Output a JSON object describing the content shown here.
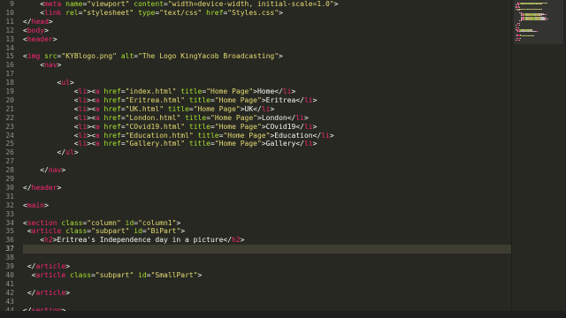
{
  "editor": {
    "lines": [
      {
        "num": "9",
        "indent": "    ",
        "tokens": [
          {
            "t": "<",
            "c": "pun"
          },
          {
            "t": "meta",
            "c": "tag"
          },
          {
            "t": " name",
            "c": "attr"
          },
          {
            "t": "=",
            "c": "pun"
          },
          {
            "t": "\"viewport\"",
            "c": "str"
          },
          {
            "t": " content",
            "c": "attr"
          },
          {
            "t": "=",
            "c": "pun"
          },
          {
            "t": "\"width=device-width, initial-scale=1.0\"",
            "c": "str"
          },
          {
            "t": ">",
            "c": "pun"
          }
        ]
      },
      {
        "num": "10",
        "indent": "    ",
        "tokens": [
          {
            "t": "<",
            "c": "pun"
          },
          {
            "t": "link",
            "c": "tag"
          },
          {
            "t": " rel",
            "c": "attr"
          },
          {
            "t": "=",
            "c": "pun"
          },
          {
            "t": "\"stylesheet\"",
            "c": "str"
          },
          {
            "t": " type",
            "c": "attr"
          },
          {
            "t": "=",
            "c": "pun"
          },
          {
            "t": "\"text/css\"",
            "c": "str"
          },
          {
            "t": " href",
            "c": "attr"
          },
          {
            "t": "=",
            "c": "pun"
          },
          {
            "t": "\"Styles.css\"",
            "c": "str"
          },
          {
            "t": ">",
            "c": "pun"
          }
        ]
      },
      {
        "num": "11",
        "indent": "",
        "tokens": [
          {
            "t": "</",
            "c": "pun"
          },
          {
            "t": "head",
            "c": "tag"
          },
          {
            "t": ">",
            "c": "pun"
          }
        ]
      },
      {
        "num": "12",
        "indent": "",
        "tokens": [
          {
            "t": "<",
            "c": "pun"
          },
          {
            "t": "body",
            "c": "tag"
          },
          {
            "t": ">",
            "c": "pun"
          }
        ]
      },
      {
        "num": "13",
        "indent": "",
        "tokens": [
          {
            "t": "<",
            "c": "pun"
          },
          {
            "t": "header",
            "c": "tag"
          },
          {
            "t": ">",
            "c": "pun"
          }
        ]
      },
      {
        "num": "14",
        "indent": "",
        "tokens": []
      },
      {
        "num": "15",
        "indent": "",
        "tokens": [
          {
            "t": "<",
            "c": "pun"
          },
          {
            "t": "img",
            "c": "tag"
          },
          {
            "t": " src",
            "c": "attr"
          },
          {
            "t": "=",
            "c": "pun"
          },
          {
            "t": "\"KYBlogo.png\"",
            "c": "str"
          },
          {
            "t": " alt",
            "c": "attr"
          },
          {
            "t": "=",
            "c": "pun"
          },
          {
            "t": "\"The Logo KingYacob Broadcasting\"",
            "c": "str"
          },
          {
            "t": ">",
            "c": "pun"
          }
        ]
      },
      {
        "num": "16",
        "indent": "    ",
        "tokens": [
          {
            "t": "<",
            "c": "pun"
          },
          {
            "t": "nav",
            "c": "tag"
          },
          {
            "t": ">",
            "c": "pun"
          }
        ]
      },
      {
        "num": "17",
        "indent": "",
        "tokens": []
      },
      {
        "num": "18",
        "indent": "        ",
        "tokens": [
          {
            "t": "<",
            "c": "pun"
          },
          {
            "t": "ul",
            "c": "tag"
          },
          {
            "t": ">",
            "c": "pun"
          }
        ]
      },
      {
        "num": "19",
        "indent": "            ",
        "tokens": [
          {
            "t": "<",
            "c": "pun"
          },
          {
            "t": "li",
            "c": "tag"
          },
          {
            "t": "><",
            "c": "pun"
          },
          {
            "t": "a",
            "c": "tag"
          },
          {
            "t": " href",
            "c": "attr"
          },
          {
            "t": "=",
            "c": "pun"
          },
          {
            "t": "\"index.html\"",
            "c": "str"
          },
          {
            "t": " title",
            "c": "attr"
          },
          {
            "t": "=",
            "c": "pun"
          },
          {
            "t": "\"Home Page\"",
            "c": "str"
          },
          {
            "t": ">Home</",
            "c": "txt"
          },
          {
            "t": "li",
            "c": "tag"
          },
          {
            "t": ">",
            "c": "pun"
          }
        ]
      },
      {
        "num": "20",
        "indent": "            ",
        "tokens": [
          {
            "t": "<",
            "c": "pun"
          },
          {
            "t": "li",
            "c": "tag"
          },
          {
            "t": "><",
            "c": "pun"
          },
          {
            "t": "a",
            "c": "tag"
          },
          {
            "t": " href",
            "c": "attr"
          },
          {
            "t": "=",
            "c": "pun"
          },
          {
            "t": "\"Eritrea.html\"",
            "c": "str"
          },
          {
            "t": " title",
            "c": "attr"
          },
          {
            "t": "=",
            "c": "pun"
          },
          {
            "t": "\"Home Page\"",
            "c": "str"
          },
          {
            "t": ">Eritrea</",
            "c": "txt"
          },
          {
            "t": "li",
            "c": "tag"
          },
          {
            "t": ">",
            "c": "pun"
          }
        ]
      },
      {
        "num": "21",
        "indent": "            ",
        "tokens": [
          {
            "t": "<",
            "c": "pun"
          },
          {
            "t": "li",
            "c": "tag"
          },
          {
            "t": "><",
            "c": "pun"
          },
          {
            "t": "a",
            "c": "tag"
          },
          {
            "t": " href",
            "c": "attr"
          },
          {
            "t": "=",
            "c": "pun"
          },
          {
            "t": "\"UK.html\"",
            "c": "str"
          },
          {
            "t": " title",
            "c": "attr"
          },
          {
            "t": "=",
            "c": "pun"
          },
          {
            "t": "\"Home Page\"",
            "c": "str"
          },
          {
            "t": ">UK</",
            "c": "txt"
          },
          {
            "t": "li",
            "c": "tag"
          },
          {
            "t": ">",
            "c": "pun"
          }
        ]
      },
      {
        "num": "22",
        "indent": "            ",
        "tokens": [
          {
            "t": "<",
            "c": "pun"
          },
          {
            "t": "li",
            "c": "tag"
          },
          {
            "t": "><",
            "c": "pun"
          },
          {
            "t": "a",
            "c": "tag"
          },
          {
            "t": " href",
            "c": "attr"
          },
          {
            "t": "=",
            "c": "pun"
          },
          {
            "t": "\"London.html\"",
            "c": "str"
          },
          {
            "t": " title",
            "c": "attr"
          },
          {
            "t": "=",
            "c": "pun"
          },
          {
            "t": "\"Home Page\"",
            "c": "str"
          },
          {
            "t": ">London</",
            "c": "txt"
          },
          {
            "t": "li",
            "c": "tag"
          },
          {
            "t": ">",
            "c": "pun"
          }
        ]
      },
      {
        "num": "23",
        "indent": "            ",
        "tokens": [
          {
            "t": "<",
            "c": "pun"
          },
          {
            "t": "li",
            "c": "tag"
          },
          {
            "t": "><",
            "c": "pun"
          },
          {
            "t": "a",
            "c": "tag"
          },
          {
            "t": " href",
            "c": "attr"
          },
          {
            "t": "=",
            "c": "pun"
          },
          {
            "t": "\"COvid19.html\"",
            "c": "str"
          },
          {
            "t": " title",
            "c": "attr"
          },
          {
            "t": "=",
            "c": "pun"
          },
          {
            "t": "\"Home Page\"",
            "c": "str"
          },
          {
            "t": ">COvid19</",
            "c": "txt"
          },
          {
            "t": "li",
            "c": "tag"
          },
          {
            "t": ">",
            "c": "pun"
          }
        ]
      },
      {
        "num": "24",
        "indent": "            ",
        "tokens": [
          {
            "t": "<",
            "c": "pun"
          },
          {
            "t": "li",
            "c": "tag"
          },
          {
            "t": "><",
            "c": "pun"
          },
          {
            "t": "a",
            "c": "tag"
          },
          {
            "t": " href",
            "c": "attr"
          },
          {
            "t": "=",
            "c": "pun"
          },
          {
            "t": "\"Education.html\"",
            "c": "str"
          },
          {
            "t": " title",
            "c": "attr"
          },
          {
            "t": "=",
            "c": "pun"
          },
          {
            "t": "\"Home Page\"",
            "c": "str"
          },
          {
            "t": ">Education</",
            "c": "txt"
          },
          {
            "t": "li",
            "c": "tag"
          },
          {
            "t": ">",
            "c": "pun"
          }
        ]
      },
      {
        "num": "25",
        "indent": "            ",
        "tokens": [
          {
            "t": "<",
            "c": "pun"
          },
          {
            "t": "li",
            "c": "tag"
          },
          {
            "t": "><",
            "c": "pun"
          },
          {
            "t": "a",
            "c": "tag"
          },
          {
            "t": " href",
            "c": "attr"
          },
          {
            "t": "=",
            "c": "pun"
          },
          {
            "t": "\"Gallery.html\"",
            "c": "str"
          },
          {
            "t": " title",
            "c": "attr"
          },
          {
            "t": "=",
            "c": "pun"
          },
          {
            "t": "\"Home Page\"",
            "c": "str"
          },
          {
            "t": ">Gallery</",
            "c": "txt"
          },
          {
            "t": "li",
            "c": "tag"
          },
          {
            "t": ">",
            "c": "pun"
          }
        ]
      },
      {
        "num": "26",
        "indent": "        ",
        "tokens": [
          {
            "t": "</",
            "c": "pun"
          },
          {
            "t": "ul",
            "c": "tag"
          },
          {
            "t": ">",
            "c": "pun"
          }
        ]
      },
      {
        "num": "27",
        "indent": "",
        "tokens": []
      },
      {
        "num": "28",
        "indent": "    ",
        "tokens": [
          {
            "t": "</",
            "c": "pun"
          },
          {
            "t": "nav",
            "c": "tag"
          },
          {
            "t": ">",
            "c": "pun"
          }
        ]
      },
      {
        "num": "29",
        "indent": "",
        "tokens": []
      },
      {
        "num": "30",
        "indent": "",
        "tokens": [
          {
            "t": "</",
            "c": "pun"
          },
          {
            "t": "header",
            "c": "tag"
          },
          {
            "t": ">",
            "c": "pun"
          }
        ]
      },
      {
        "num": "31",
        "indent": "",
        "tokens": []
      },
      {
        "num": "32",
        "indent": "",
        "tokens": [
          {
            "t": "<",
            "c": "pun"
          },
          {
            "t": "main",
            "c": "tag"
          },
          {
            "t": ">",
            "c": "pun"
          }
        ]
      },
      {
        "num": "33",
        "indent": "",
        "tokens": []
      },
      {
        "num": "34",
        "indent": "",
        "tokens": [
          {
            "t": "<",
            "c": "pun"
          },
          {
            "t": "section",
            "c": "tag"
          },
          {
            "t": " class",
            "c": "attr"
          },
          {
            "t": "=",
            "c": "pun"
          },
          {
            "t": "\"column\"",
            "c": "str"
          },
          {
            "t": " id",
            "c": "attr"
          },
          {
            "t": "=",
            "c": "pun"
          },
          {
            "t": "\"column1\"",
            "c": "str"
          },
          {
            "t": ">",
            "c": "pun"
          }
        ]
      },
      {
        "num": "35",
        "indent": " ",
        "tokens": [
          {
            "t": "<",
            "c": "pun"
          },
          {
            "t": "article",
            "c": "tag"
          },
          {
            "t": " class",
            "c": "attr"
          },
          {
            "t": "=",
            "c": "pun"
          },
          {
            "t": "\"subpart\"",
            "c": "str"
          },
          {
            "t": " id",
            "c": "attr"
          },
          {
            "t": "=",
            "c": "pun"
          },
          {
            "t": "\"BiPart\"",
            "c": "str"
          },
          {
            "t": ">",
            "c": "pun"
          }
        ]
      },
      {
        "num": "36",
        "indent": "    ",
        "tokens": [
          {
            "t": "<",
            "c": "pun"
          },
          {
            "t": "h2",
            "c": "tag"
          },
          {
            "t": ">Eritrea's Independence day in a picture</",
            "c": "txt"
          },
          {
            "t": "h2",
            "c": "tag"
          },
          {
            "t": ">",
            "c": "pun"
          }
        ]
      },
      {
        "num": "37",
        "indent": "",
        "tokens": [],
        "current": true
      },
      {
        "num": "38",
        "indent": "",
        "tokens": []
      },
      {
        "num": "39",
        "indent": " ",
        "tokens": [
          {
            "t": "</",
            "c": "pun"
          },
          {
            "t": "article",
            "c": "tag"
          },
          {
            "t": ">",
            "c": "pun"
          }
        ]
      },
      {
        "num": "40",
        "indent": "  ",
        "tokens": [
          {
            "t": "<",
            "c": "pun"
          },
          {
            "t": "article",
            "c": "tag"
          },
          {
            "t": " class",
            "c": "attr"
          },
          {
            "t": "=",
            "c": "pun"
          },
          {
            "t": "\"subpart\"",
            "c": "str"
          },
          {
            "t": " id",
            "c": "attr"
          },
          {
            "t": "=",
            "c": "pun"
          },
          {
            "t": "\"SmallPart\"",
            "c": "str"
          },
          {
            "t": ">",
            "c": "pun"
          }
        ]
      },
      {
        "num": "41",
        "indent": "",
        "tokens": []
      },
      {
        "num": "42",
        "indent": " ",
        "tokens": [
          {
            "t": "</",
            "c": "pun"
          },
          {
            "t": "article",
            "c": "tag"
          },
          {
            "t": ">",
            "c": "pun"
          }
        ]
      },
      {
        "num": "43",
        "indent": "",
        "tokens": []
      },
      {
        "num": "44",
        "indent": "",
        "tokens": [
          {
            "t": "</",
            "c": "pun"
          },
          {
            "t": "section",
            "c": "tag"
          },
          {
            "t": ">",
            "c": "pun"
          }
        ]
      }
    ]
  },
  "colors": {
    "background": "#272822",
    "tag": "#f92672",
    "attribute": "#a6e22e",
    "string": "#e6db74",
    "text": "#f8f8f2",
    "gutter": "#8f908a"
  }
}
